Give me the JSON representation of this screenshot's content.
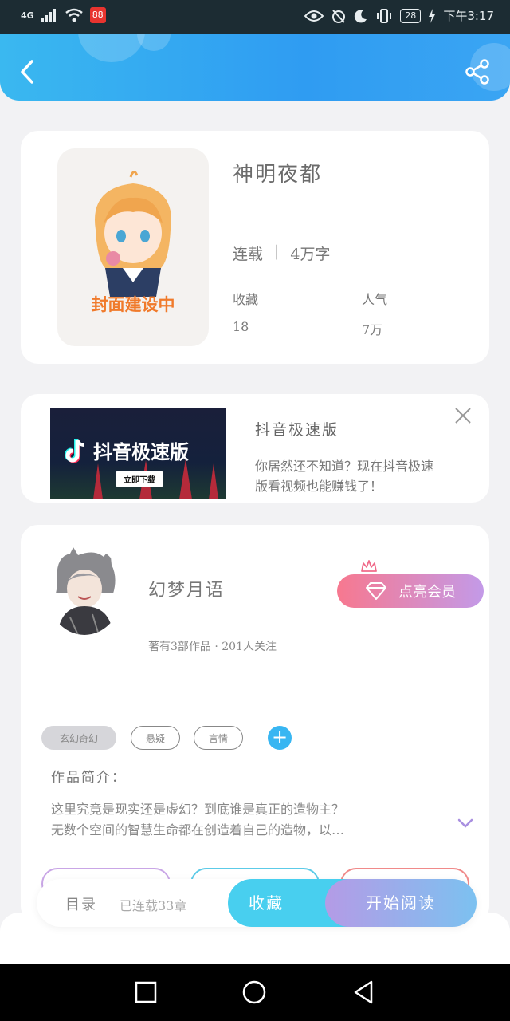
{
  "status_bar": {
    "network": "4G",
    "app_badge": "88",
    "battery": "28",
    "time": "下午3:17"
  },
  "header": {
    "back_icon": "chevron-left-icon",
    "share_icon": "share-icon"
  },
  "book": {
    "cover_text": "封面建设中",
    "title": "神明夜都",
    "status": "连载",
    "word_count": "4万字",
    "favorites_label": "收藏",
    "favorites_value": "18",
    "popularity_label": "人气",
    "popularity_value": "7万"
  },
  "ad": {
    "image_brand": "抖音极速版",
    "image_download": "立即下载",
    "title": "抖音极速版",
    "desc_line1": "你居然还不知道？现在抖音极速",
    "desc_line2": "版看视频也能赚钱了！",
    "close_icon": "close-icon"
  },
  "author": {
    "name": "幻梦月语",
    "meta": "著有3部作品 · 201人关注",
    "vip_label": "点亮会员",
    "tags": [
      "玄幻奇幻",
      "悬疑",
      "言情"
    ],
    "intro_label": "作品简介：",
    "intro_line1": "这里究竟是现实还是虚幻？到底谁是真正的造物主？",
    "intro_line2": "无数个空间的智慧生命都在创造着自己的造物，以…"
  },
  "bottom_bar": {
    "catalog": "目录",
    "chapters": "已连载33章",
    "collect": "收藏",
    "read": "开始阅读"
  },
  "colors": {
    "header": "#2f9cf2",
    "accent_blue": "#48cfef",
    "vip_pink": "#f7788f",
    "vip_purple": "#c39ae8"
  }
}
